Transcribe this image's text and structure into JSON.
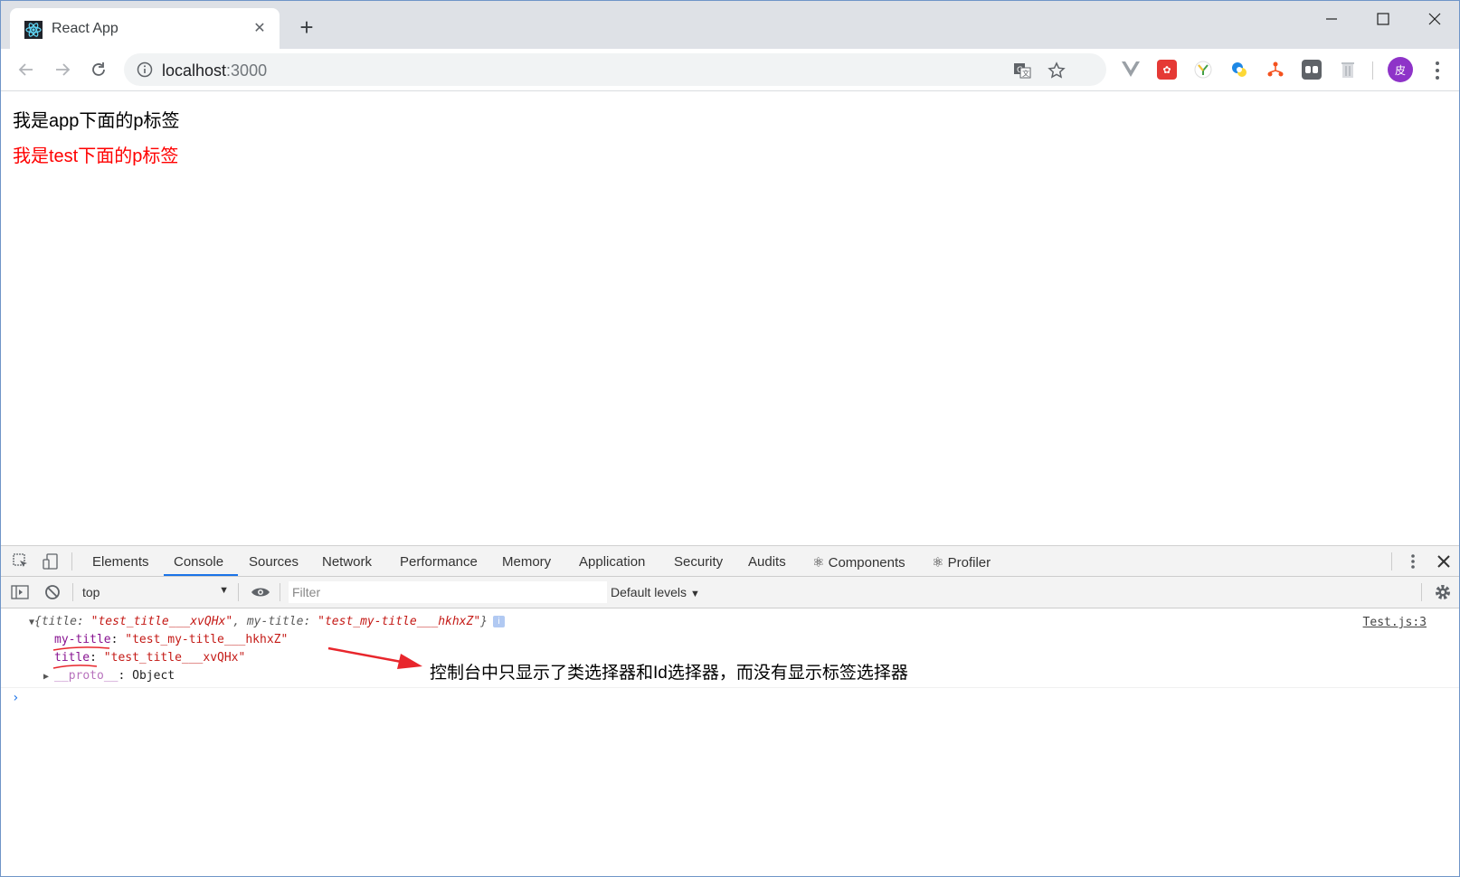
{
  "tab": {
    "title": "React App",
    "favicon": "react-icon"
  },
  "window_controls": {
    "minimize": "minimize-icon",
    "maximize": "maximize-icon",
    "close": "close-icon"
  },
  "address_bar": {
    "host": "localhost",
    "port": ":3000"
  },
  "account": {
    "avatar_text": "皮"
  },
  "page": {
    "p_app": "我是app下面的p标签",
    "p_test": "我是test下面的p标签",
    "p_test_color": "#ff0000"
  },
  "devtools": {
    "tabs": [
      "Elements",
      "Console",
      "Sources",
      "Network",
      "Performance",
      "Memory",
      "Application",
      "Security",
      "Audits",
      "⚛ Components",
      "⚛ Profiler"
    ],
    "active_tab": "Console",
    "context": "top",
    "filter_placeholder": "Filter",
    "levels": "Default levels",
    "log": {
      "summary_open": "{",
      "summary_k1": "title",
      "summary_v1": "\"test_title___xvQHx\"",
      "summary_k2": "my-title",
      "summary_v2": "\"test_my-title___hkhxZ\"",
      "summary_close": "}",
      "source": "Test.js:3",
      "props": [
        {
          "key": "my-title",
          "value": "\"test_my-title___hkhxZ\""
        },
        {
          "key": "title",
          "value": "\"test_title___xvQHx\""
        },
        {
          "key": "__proto__",
          "value": "Object"
        }
      ]
    }
  },
  "annotation": {
    "text": "控制台中只显示了类选择器和Id选择器，而没有显示标签选择器",
    "arrow_color": "#e8262c"
  }
}
